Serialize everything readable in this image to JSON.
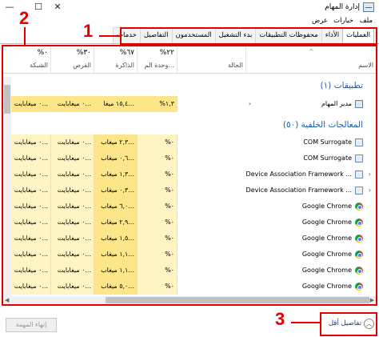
{
  "window": {
    "title": "إدارة المهام",
    "minimize_glyph": "—",
    "maximize_glyph": "☐",
    "close_glyph": "✕"
  },
  "menu": [
    "ملف",
    "خيارات",
    "عرض"
  ],
  "tabs": [
    "العمليات",
    "الأداء",
    "محفوظات التطبيقات",
    "بدء التشغيل",
    "المستخدمون",
    "التفاصيل",
    "خدمات"
  ],
  "annotations": [
    "1",
    "2",
    "3"
  ],
  "columns": {
    "name": {
      "label": "الاسم"
    },
    "status": {
      "label": "الحالة"
    },
    "cpu": {
      "pct": "%٢٢",
      "label": "وحدة الم..."
    },
    "memory": {
      "pct": "%٦٧",
      "label": "الذاكرة"
    },
    "disk": {
      "pct": "%٣٠",
      "label": "القرص"
    },
    "network": {
      "pct": "%٠",
      "label": "الشبكة"
    }
  },
  "groups": {
    "apps": "تطبيقات (١)",
    "background": "المعالجات الخلفية (٥٠)"
  },
  "rows": [
    {
      "name": "مدير المهام",
      "icon": "task-manager-icon",
      "cpu": "%١,٣",
      "memory": "١٥,٤ ميغا...",
      "disk": "٠ ميغابايت...",
      "network": "٠ ميغابايت..."
    },
    {
      "name": "COM Surrogate",
      "icon": "window-icon",
      "cpu": "%٠",
      "memory": "٢,٣ ميغاب...",
      "disk": "٠ ميغابايت...",
      "network": "٠ ميغابايت..."
    },
    {
      "name": "COM Surrogate",
      "icon": "window-icon",
      "cpu": "%٠",
      "memory": "٠,٦ ميغاب...",
      "disk": "٠ ميغابايت...",
      "network": "٠ ميغابايت..."
    },
    {
      "name": "Device Association Framework ...",
      "icon": "window-icon",
      "cpu": "%٠",
      "memory": "١,٣ ميغاب...",
      "disk": "٠ ميغابايت...",
      "network": "٠ ميغابايت..."
    },
    {
      "name": "Device Association Framework ...",
      "icon": "window-icon",
      "cpu": "%٠",
      "memory": "٠,٣ ميغاب...",
      "disk": "٠ ميغابايت...",
      "network": "٠ ميغابايت..."
    },
    {
      "name": "Google Chrome",
      "icon": "chrome-icon",
      "cpu": "%٠",
      "memory": "٦,٠ ميغاب...",
      "disk": "٠ ميغابايت...",
      "network": "٠ ميغابايت..."
    },
    {
      "name": "Google Chrome",
      "icon": "chrome-icon",
      "cpu": "%٠",
      "memory": "٢,٩ ميغاب...",
      "disk": "٠ ميغابايت...",
      "network": "٠ ميغابايت..."
    },
    {
      "name": "Google Chrome",
      "icon": "chrome-icon",
      "cpu": "%٠",
      "memory": "١,٥ ميغاب...",
      "disk": "٠ ميغابايت...",
      "network": "٠ ميغابايت..."
    },
    {
      "name": "Google Chrome",
      "icon": "chrome-icon",
      "cpu": "%٠",
      "memory": "١,١ ميغاب...",
      "disk": "٠ ميغابايت...",
      "network": "٠ ميغابايت..."
    },
    {
      "name": "Google Chrome",
      "icon": "chrome-icon",
      "cpu": "%٠",
      "memory": "١,١ ميغاب...",
      "disk": "٠ ميغابايت...",
      "network": "٠ ميغابايت..."
    },
    {
      "name": "Google Chrome",
      "icon": "chrome-icon",
      "cpu": "%٠",
      "memory": "٥,٠ ميغاب...",
      "disk": "٠ ميغابايت...",
      "network": "٠ ميغابايت..."
    }
  ],
  "footer": {
    "end_task": "إنهاء المهمة",
    "fewer_details": "تفاصيل أقل"
  },
  "colors": {
    "annotation": "#e00000",
    "group_title": "#1a5fb4",
    "cell_bg": "#fff4c4",
    "cell_bg_highlight": "#fde68a"
  }
}
